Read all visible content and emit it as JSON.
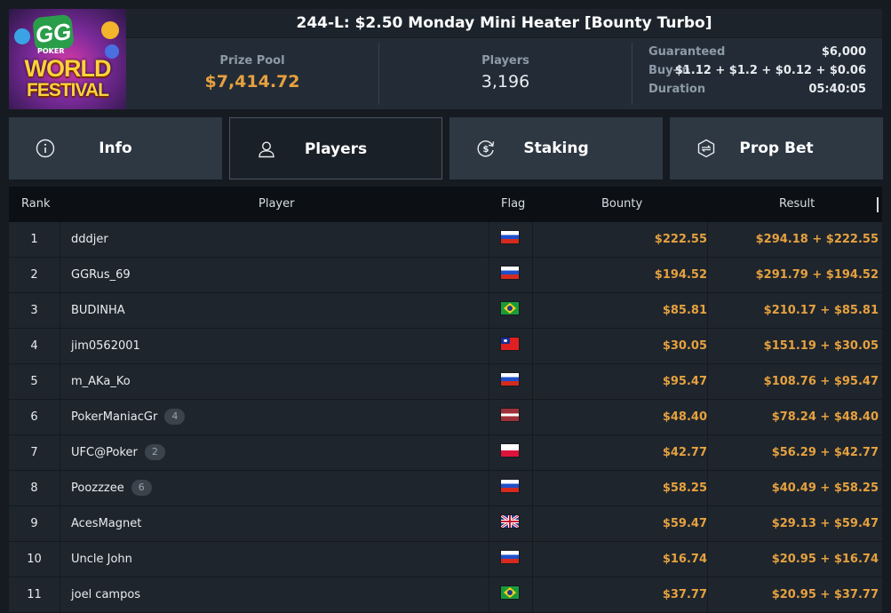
{
  "tournament": {
    "title": "244-L: $2.50 Monday Mini Heater [Bounty Turbo]",
    "logo": {
      "gg": "GG",
      "poker": "POKER",
      "line1": "WORLD",
      "line2": "FESTIVAL"
    }
  },
  "stats": {
    "prize_pool_label": "Prize Pool",
    "prize_pool_value": "$7,414.72",
    "players_label": "Players",
    "players_value": "3,196",
    "guaranteed_label": "Guaranteed",
    "guaranteed_value": "$6,000",
    "buyin_label": "Buy-in",
    "buyin_value": "$1.12 + $1.2 + $0.12 + $0.06",
    "duration_label": "Duration",
    "duration_value": "05:40:05"
  },
  "tabs": [
    {
      "label": "Info",
      "icon": "info-icon"
    },
    {
      "label": "Players",
      "icon": "user-icon",
      "active": true
    },
    {
      "label": "Staking",
      "icon": "dollar-refresh-icon"
    },
    {
      "label": "Prop Bet",
      "icon": "prop-bet-icon"
    }
  ],
  "table": {
    "headers": {
      "rank": "Rank",
      "player": "Player",
      "flag": "Flag",
      "bounty": "Bounty",
      "result": "Result"
    },
    "rows": [
      {
        "rank": "1",
        "player": "dddjer",
        "badge": "",
        "flag": "ru",
        "bounty": "$222.55",
        "result": "$294.18 + $222.55"
      },
      {
        "rank": "2",
        "player": "GGRus_69",
        "badge": "",
        "flag": "ru",
        "bounty": "$194.52",
        "result": "$291.79 + $194.52"
      },
      {
        "rank": "3",
        "player": "BUDINHA",
        "badge": "",
        "flag": "br",
        "bounty": "$85.81",
        "result": "$210.17 + $85.81"
      },
      {
        "rank": "4",
        "player": "jim0562001",
        "badge": "",
        "flag": "tw",
        "bounty": "$30.05",
        "result": "$151.19 + $30.05"
      },
      {
        "rank": "5",
        "player": "m_AKa_Ko",
        "badge": "",
        "flag": "ru",
        "bounty": "$95.47",
        "result": "$108.76 + $95.47"
      },
      {
        "rank": "6",
        "player": "PokerManiacGr",
        "badge": "4",
        "flag": "lv",
        "bounty": "$48.40",
        "result": "$78.24 + $48.40"
      },
      {
        "rank": "7",
        "player": "UFC@Poker",
        "badge": "2",
        "flag": "pl",
        "bounty": "$42.77",
        "result": "$56.29 + $42.77"
      },
      {
        "rank": "8",
        "player": "Poozzzee",
        "badge": "6",
        "flag": "ru",
        "bounty": "$58.25",
        "result": "$40.49 + $58.25"
      },
      {
        "rank": "9",
        "player": "AcesMagnet",
        "badge": "",
        "flag": "gb",
        "bounty": "$59.47",
        "result": "$29.13 + $59.47"
      },
      {
        "rank": "10",
        "player": "Uncle John",
        "badge": "",
        "flag": "ru",
        "bounty": "$16.74",
        "result": "$20.95 + $16.74"
      },
      {
        "rank": "11",
        "player": "joel campos",
        "badge": "",
        "flag": "br",
        "bounty": "$37.77",
        "result": "$20.95 + $37.77"
      }
    ]
  },
  "colors": {
    "accent_gold": "#e6a13f",
    "background": "#161b21",
    "panel": "#232c36",
    "tab": "#2e3843"
  }
}
